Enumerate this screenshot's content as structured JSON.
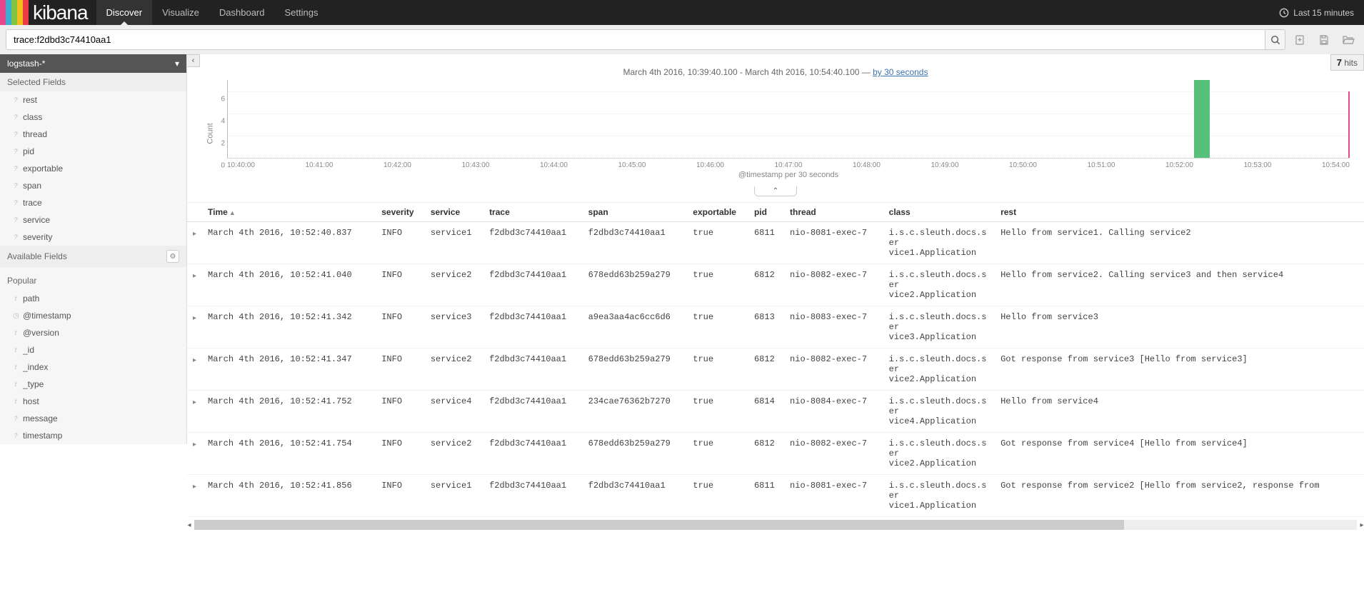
{
  "app": {
    "logo_text": "kibana",
    "nav": [
      "Discover",
      "Visualize",
      "Dashboard",
      "Settings"
    ],
    "active_nav": 0,
    "time_picker": "Last 15 minutes"
  },
  "query": {
    "text": "trace:f2dbd3c74410aa1",
    "tools": [
      "new-search",
      "save-search",
      "load-search"
    ]
  },
  "hits": {
    "count": "7",
    "label": "hits"
  },
  "sidebar": {
    "index_pattern": "logstash-*",
    "selected_fields_label": "Selected Fields",
    "selected_fields": [
      {
        "type": "?",
        "name": "rest"
      },
      {
        "type": "?",
        "name": "class"
      },
      {
        "type": "?",
        "name": "thread"
      },
      {
        "type": "?",
        "name": "pid"
      },
      {
        "type": "?",
        "name": "exportable"
      },
      {
        "type": "?",
        "name": "span"
      },
      {
        "type": "?",
        "name": "trace"
      },
      {
        "type": "?",
        "name": "service"
      },
      {
        "type": "?",
        "name": "severity"
      }
    ],
    "available_fields_label": "Available Fields",
    "popular_label": "Popular",
    "available_fields": [
      {
        "type": "t",
        "name": "path"
      },
      {
        "type": "clock",
        "name": "@timestamp"
      },
      {
        "type": "t",
        "name": "@version"
      },
      {
        "type": "t",
        "name": "_id"
      },
      {
        "type": "t",
        "name": "_index"
      },
      {
        "type": "t",
        "name": "_type"
      },
      {
        "type": "t",
        "name": "host"
      },
      {
        "type": "?",
        "name": "message"
      },
      {
        "type": "?",
        "name": "timestamp"
      }
    ]
  },
  "histogram": {
    "range_text_prefix": "March 4th 2016, 10:39:40.100 - March 4th 2016, 10:54:40.100 — ",
    "interval_link": "by 30 seconds",
    "ylabel": "Count",
    "xaxis_label": "@timestamp per 30 seconds",
    "yticks": [
      0,
      2,
      4,
      6
    ],
    "xticks": [
      "10:40:00",
      "10:41:00",
      "10:42:00",
      "10:43:00",
      "10:44:00",
      "10:45:00",
      "10:46:00",
      "10:47:00",
      "10:48:00",
      "10:49:00",
      "10:50:00",
      "10:51:00",
      "10:52:00",
      "10:53:00",
      "10:54:00"
    ]
  },
  "chart_data": {
    "type": "bar",
    "title": "",
    "xlabel": "@timestamp per 30 seconds",
    "ylabel": "Count",
    "ylim": [
      0,
      7
    ],
    "categories_interval_seconds": 30,
    "series": [
      {
        "name": "hits",
        "color": "#57C17B",
        "bars": [
          {
            "x": "10:52:30",
            "value": 7
          }
        ]
      }
    ]
  },
  "table": {
    "columns": [
      "Time",
      "severity",
      "service",
      "trace",
      "span",
      "exportable",
      "pid",
      "thread",
      "class",
      "rest"
    ],
    "sort_col": "Time",
    "sort_dir": "asc",
    "rows": [
      {
        "time": "March 4th 2016, 10:52:40.837",
        "severity": "INFO",
        "service": "service1",
        "trace": "f2dbd3c74410aa1",
        "span": "f2dbd3c74410aa1",
        "exportable": "true",
        "pid": "6811",
        "thread": "nio-8081-exec-7",
        "class": "i.s.c.sleuth.docs.service1.Application",
        "rest": "Hello from service1. Calling service2"
      },
      {
        "time": "March 4th 2016, 10:52:41.040",
        "severity": "INFO",
        "service": "service2",
        "trace": "f2dbd3c74410aa1",
        "span": "678edd63b259a279",
        "exportable": "true",
        "pid": "6812",
        "thread": "nio-8082-exec-7",
        "class": "i.s.c.sleuth.docs.service2.Application",
        "rest": "Hello from service2. Calling service3 and then service4"
      },
      {
        "time": "March 4th 2016, 10:52:41.342",
        "severity": "INFO",
        "service": "service3",
        "trace": "f2dbd3c74410aa1",
        "span": "a9ea3aa4ac6cc6d6",
        "exportable": "true",
        "pid": "6813",
        "thread": "nio-8083-exec-7",
        "class": "i.s.c.sleuth.docs.service3.Application",
        "rest": "Hello from service3"
      },
      {
        "time": "March 4th 2016, 10:52:41.347",
        "severity": "INFO",
        "service": "service2",
        "trace": "f2dbd3c74410aa1",
        "span": "678edd63b259a279",
        "exportable": "true",
        "pid": "6812",
        "thread": "nio-8082-exec-7",
        "class": "i.s.c.sleuth.docs.service2.Application",
        "rest": "Got response from service3 [Hello from service3]"
      },
      {
        "time": "March 4th 2016, 10:52:41.752",
        "severity": "INFO",
        "service": "service4",
        "trace": "f2dbd3c74410aa1",
        "span": "234cae76362b7270",
        "exportable": "true",
        "pid": "6814",
        "thread": "nio-8084-exec-7",
        "class": "i.s.c.sleuth.docs.service4.Application",
        "rest": "Hello from service4"
      },
      {
        "time": "March 4th 2016, 10:52:41.754",
        "severity": "INFO",
        "service": "service2",
        "trace": "f2dbd3c74410aa1",
        "span": "678edd63b259a279",
        "exportable": "true",
        "pid": "6812",
        "thread": "nio-8082-exec-7",
        "class": "i.s.c.sleuth.docs.service2.Application",
        "rest": "Got response from service4 [Hello from service4]"
      },
      {
        "time": "March 4th 2016, 10:52:41.856",
        "severity": "INFO",
        "service": "service1",
        "trace": "f2dbd3c74410aa1",
        "span": "f2dbd3c74410aa1",
        "exportable": "true",
        "pid": "6811",
        "thread": "nio-8081-exec-7",
        "class": "i.s.c.sleuth.docs.service1.Application",
        "rest": "Got response from service2 [Hello from service2, response from"
      }
    ]
  }
}
